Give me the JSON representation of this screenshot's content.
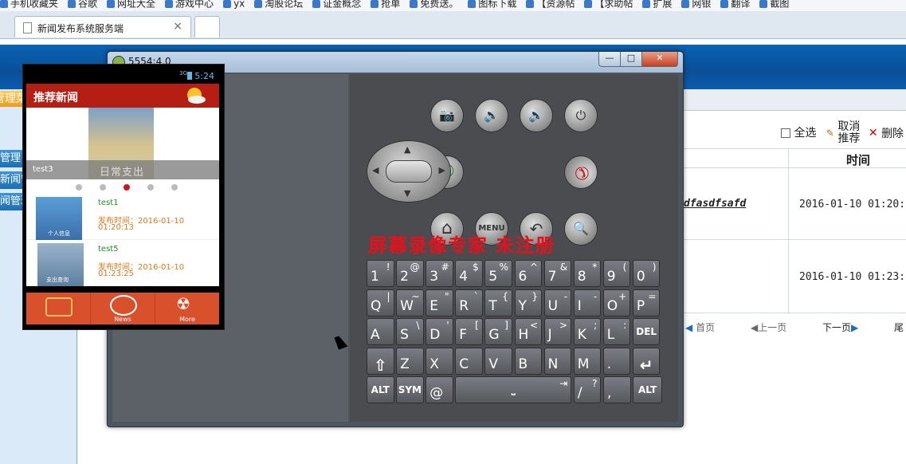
{
  "bookmarks": [
    "手机收藏夹",
    "谷歌",
    "网址大全",
    "游戏中心",
    "yx",
    "淘股论坛",
    "证金概念",
    "抢单",
    "免费送。",
    "图标下载",
    "【资源帖",
    "【求助帖",
    "扩展",
    "网银",
    "翻译",
    "截图"
  ],
  "browser_tab": {
    "title": "新闻发布系统服务端",
    "close": "×"
  },
  "web": {
    "menu_title": "管理菜单",
    "menu_items": [
      "新闻管理",
      "推荐新闻管理",
      "类新闻管理"
    ],
    "breadcrumb": "当",
    "toolbar": {
      "select_all": "全选",
      "cancel_recommend_1": "取消",
      "cancel_recommend_2": "推荐",
      "delete": "删除"
    },
    "table": {
      "header_time": "时间",
      "rows": [
        {
          "title": "dfasdfsafd",
          "time": "2016-01-10 01:20:"
        },
        {
          "title": "",
          "time": "2016-01-10 01:23:"
        }
      ]
    },
    "pager": {
      "first": "首页",
      "prev": "上一页",
      "next": "下一页",
      "last": "尾"
    }
  },
  "emulator": {
    "title": "5554:4.0",
    "window_controls": {
      "min": "—",
      "max": "□",
      "close": "✕"
    },
    "status": {
      "network": "3G",
      "time": "5:24"
    },
    "app": {
      "title": "推荐新闻",
      "banner_caption": "test3",
      "banner_image_text": "日常支出",
      "dots_active_index": 2,
      "news": [
        {
          "title": "test1",
          "time_label": "发布时间：2016-01-10",
          "time_rest": "01:20:13",
          "thumb_text": "个人信息"
        },
        {
          "title": "test5",
          "time_label": "发布时间：2016-01-10",
          "time_rest": "01:23:25",
          "thumb_text": "支出查询"
        }
      ],
      "bottom_tabs": [
        "",
        "News",
        "More"
      ]
    },
    "hw_buttons": {
      "camera": "📷",
      "vol_down": "🔉",
      "vol_up": "🔊",
      "power": "⏻",
      "call": "✆",
      "end": "✆",
      "home": "⌂",
      "menu": "MENU",
      "back": "↶",
      "search": "🔍"
    },
    "keyboard": {
      "row1": [
        [
          "1",
          "!"
        ],
        [
          "2",
          "@"
        ],
        [
          "3",
          "#"
        ],
        [
          "4",
          "$"
        ],
        [
          "5",
          "%"
        ],
        [
          "6",
          "^"
        ],
        [
          "7",
          "&"
        ],
        [
          "8",
          "*"
        ],
        [
          "9",
          "("
        ],
        [
          "0",
          ")"
        ]
      ],
      "row2": [
        [
          "Q",
          "|"
        ],
        [
          "W",
          "~"
        ],
        [
          "E",
          "\""
        ],
        [
          "R",
          "`"
        ],
        [
          "T",
          "{"
        ],
        [
          "Y",
          "}"
        ],
        [
          "U",
          "-"
        ],
        [
          "I",
          "-"
        ],
        [
          "O",
          "+"
        ],
        [
          "P",
          "="
        ]
      ],
      "row3": [
        [
          "A",
          ""
        ],
        [
          "S",
          "\\"
        ],
        [
          "D",
          "'"
        ],
        [
          "F",
          "["
        ],
        [
          "G",
          "]"
        ],
        [
          "H",
          "<"
        ],
        [
          "J",
          ">"
        ],
        [
          "K",
          ";"
        ],
        [
          "L",
          ":"
        ],
        [
          "DEL",
          ""
        ]
      ],
      "row4": [
        [
          "⇧",
          ""
        ],
        [
          "Z",
          ""
        ],
        [
          "X",
          ""
        ],
        [
          "C",
          ""
        ],
        [
          "V",
          ""
        ],
        [
          "B",
          ""
        ],
        [
          "N",
          ""
        ],
        [
          "M",
          ""
        ],
        [
          ".",
          ""
        ],
        [
          "↵",
          ""
        ]
      ],
      "row5": {
        "alt_left": "ALT",
        "sym": "SYM",
        "at": "@",
        "space": "⎵",
        "tab_arrow": "⇥",
        "slash": "/",
        "question": "?",
        "comma": ",",
        "alt_right": "ALT"
      }
    }
  },
  "watermark": "屏幕录像专家 未注册"
}
